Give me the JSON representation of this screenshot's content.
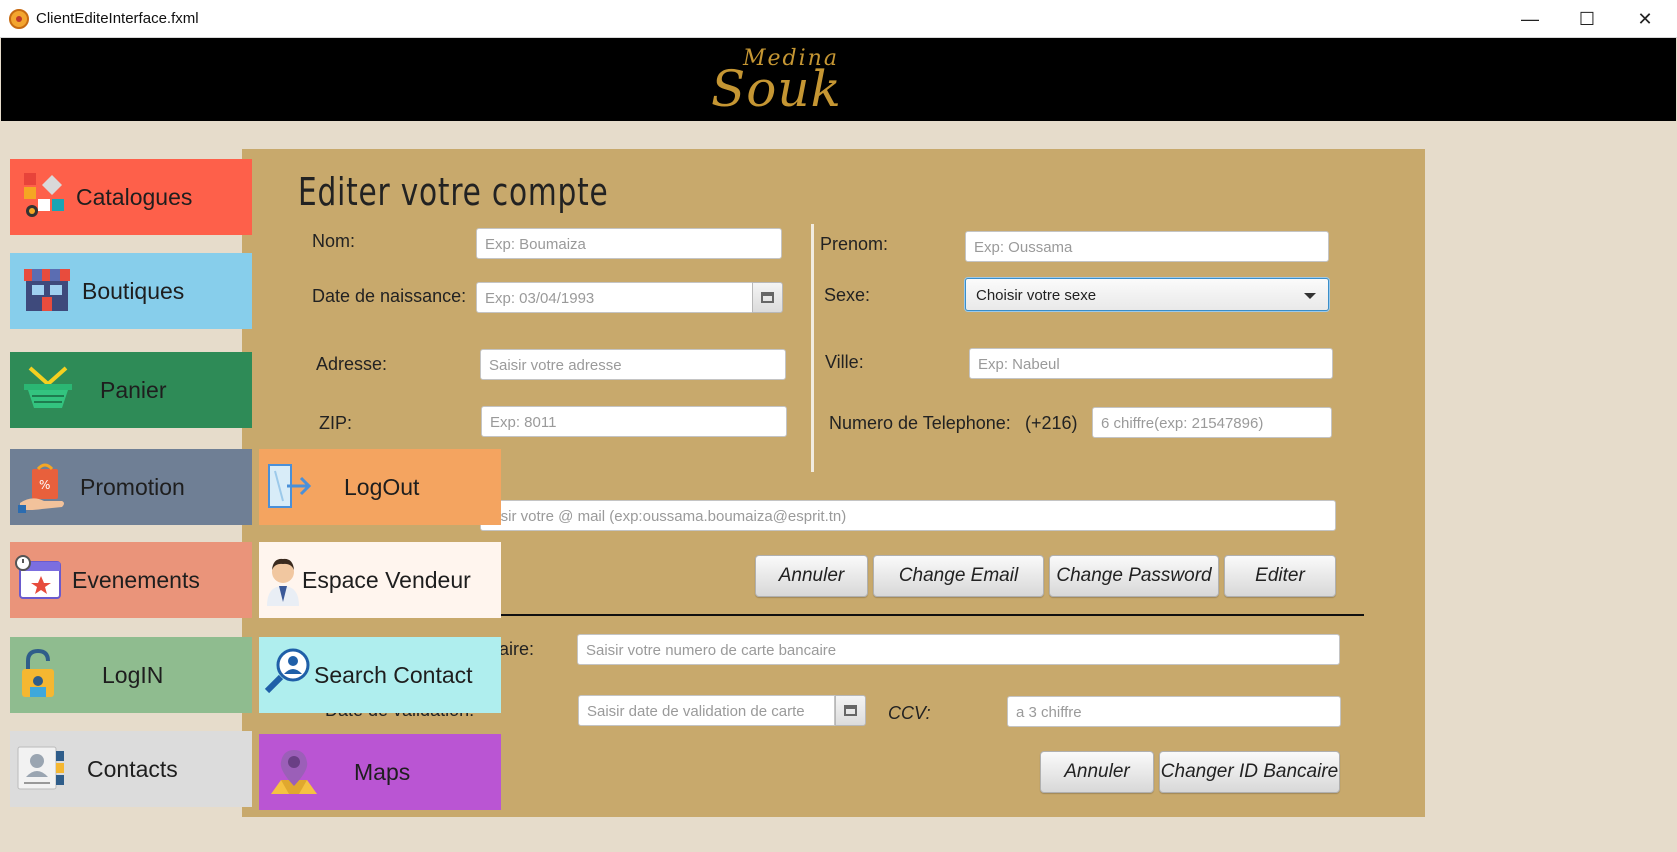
{
  "window": {
    "title": "ClientEditeInterface.fxml",
    "minimize": "—",
    "maximize": "☐",
    "close": "✕"
  },
  "logo": {
    "medina": "Medina",
    "souk": "Souk"
  },
  "page_title": "Editer votre compte",
  "form": {
    "nom": {
      "label": "Nom:",
      "placeholder": "Exp: Boumaiza"
    },
    "prenom": {
      "label": "Prenom:",
      "placeholder": "Exp: Oussama"
    },
    "date_naissance": {
      "label": "Date de naissance:",
      "placeholder": "Exp: 03/04/1993"
    },
    "sexe": {
      "label": "Sexe:",
      "value": "Choisir votre sexe"
    },
    "adresse": {
      "label": "Adresse:",
      "placeholder": "Saisir votre adresse"
    },
    "ville": {
      "label": "Ville:",
      "placeholder": "Exp: Nabeul"
    },
    "zip": {
      "label": "ZIP:",
      "placeholder": "Exp: 8011"
    },
    "telephone": {
      "label": "Numero de Telephone:",
      "prefix": "(+216)",
      "placeholder": "6 chiffre(exp: 21547896)"
    },
    "email": {
      "placeholder": "aisir votre @ mail (exp:oussama.boumaiza@esprit.tn)"
    },
    "buttons": {
      "annuler": "Annuler",
      "change_email": "Change Email",
      "change_password": "Change Password",
      "editer": "Editer"
    }
  },
  "bank": {
    "carte_label": "caire:",
    "carte_placeholder": "Saisir votre numero de carte bancaire",
    "validation_label": "Date de validation:",
    "validation_placeholder": "Saisir date de validation de carte",
    "ccv_label": "CCV:",
    "ccv_placeholder": "a 3 chiffre",
    "buttons": {
      "annuler": "Annuler",
      "changer_id": "Changer ID Bancaire"
    }
  },
  "nav": {
    "catalogues": "Catalogues",
    "boutiques": "Boutiques",
    "panier": "Panier",
    "promotion": "Promotion",
    "evenements": "Evenements",
    "login": "LogIN",
    "contacts": "Contacts",
    "logout": "LogOut",
    "espace_vendeur": "Espace Vendeur",
    "search_contact": "Search Contact",
    "maps": "Maps"
  },
  "colors": {
    "catalogues": "#fe604a",
    "boutiques": "#87ceeb",
    "panier": "#2e8b57",
    "promotion": "#6f7f95",
    "evenements": "#ea947a",
    "login": "#8fbc8f",
    "contacts": "#dcdcdc",
    "logout": "#f4a460",
    "espace_vendeur": "#fff5ee",
    "search_contact": "#afeeee",
    "maps": "#ba55d3",
    "panel": "#c8a96c",
    "background": "#e6dccb"
  }
}
